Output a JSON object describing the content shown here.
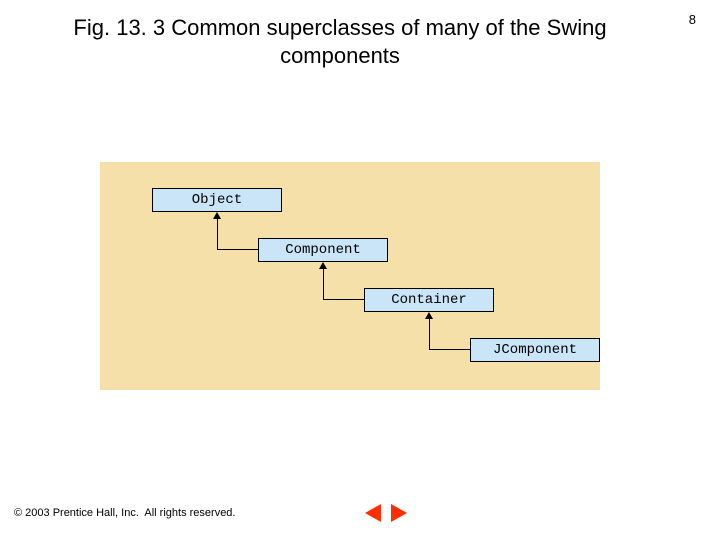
{
  "page_number": "8",
  "title": "Fig. 13. 3  Common superclasses of many of the Swing components",
  "hierarchy": {
    "class0": "Object",
    "class1": "Component",
    "class2": "Container",
    "class3": "JComponent"
  },
  "footer": {
    "copyright": "© 2003 Prentice Hall, Inc.  All rights reserved."
  },
  "nav": {
    "prev_icon": "triangle-left",
    "next_icon": "triangle-right"
  },
  "colors": {
    "canvas_bg": "#f4e0a8",
    "box_fill": "#c9e5f7",
    "nav_button": "#ff2d00"
  }
}
